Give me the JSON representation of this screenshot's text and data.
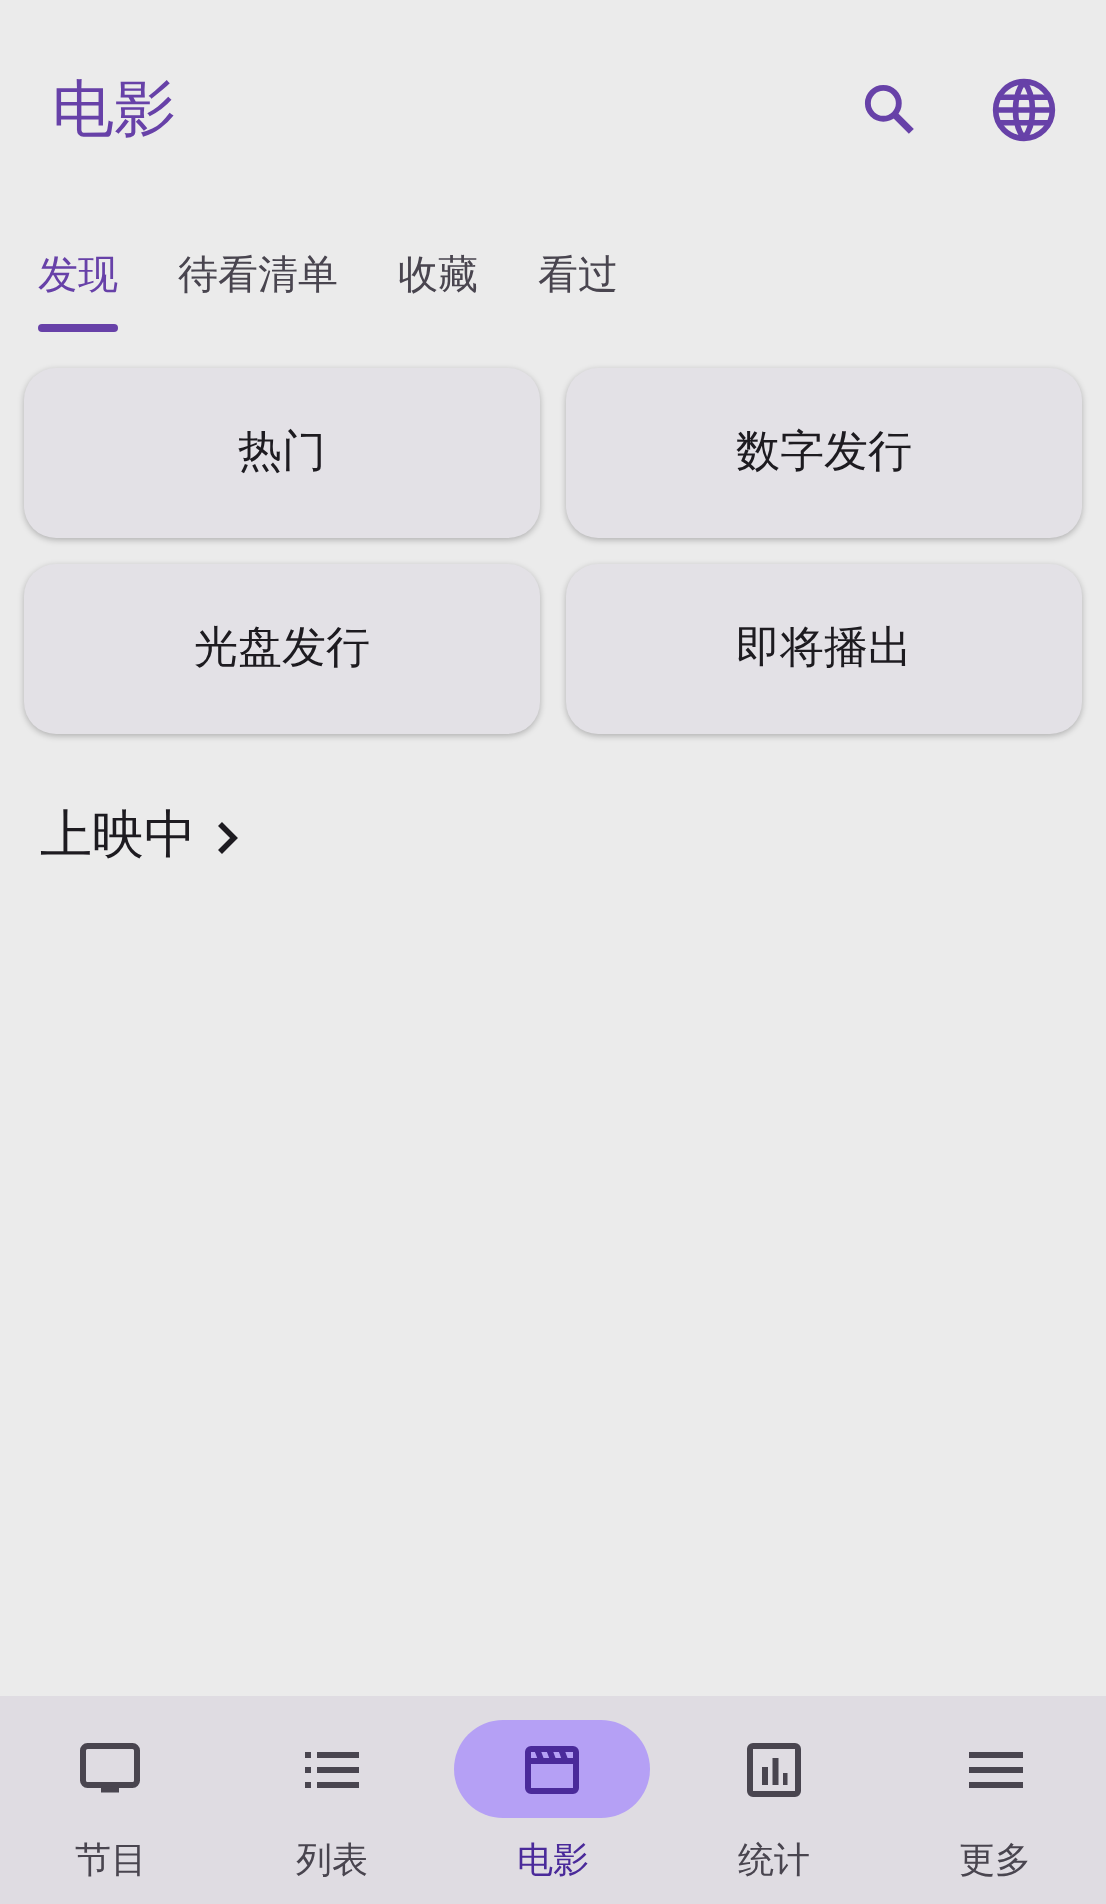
{
  "app_bar": {
    "title": "电影"
  },
  "tabs": [
    {
      "label": "发现",
      "selected": true
    },
    {
      "label": "待看清单",
      "selected": false
    },
    {
      "label": "收藏",
      "selected": false
    },
    {
      "label": "看过",
      "selected": false
    }
  ],
  "categories": [
    "热门",
    "数字发行",
    "光盘发行",
    "即将播出"
  ],
  "section": {
    "title": "上映中"
  },
  "bottom_nav": [
    {
      "label": "节目",
      "selected": false
    },
    {
      "label": "列表",
      "selected": false
    },
    {
      "label": "电影",
      "selected": true
    },
    {
      "label": "统计",
      "selected": false
    },
    {
      "label": "更多",
      "selected": false
    }
  ]
}
